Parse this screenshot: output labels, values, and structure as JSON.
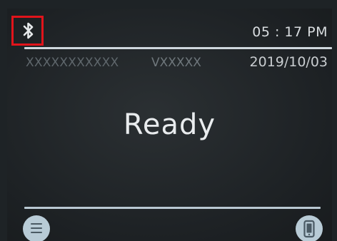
{
  "status_bar": {
    "bluetooth_icon": "bluetooth-icon",
    "time": "05 : 17 PM",
    "highlight_color": "#e1141b"
  },
  "info_row": {
    "serial": "XXXXXXXXXXX",
    "version": "VXXXXX",
    "date": "2019/10/03"
  },
  "main": {
    "status": "Ready"
  },
  "bottom_bar": {
    "menu_icon": "menu-icon",
    "phone_icon": "phone-icon"
  }
}
